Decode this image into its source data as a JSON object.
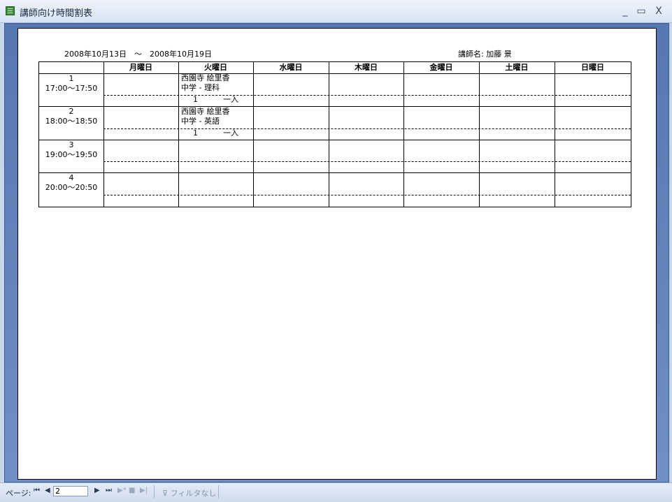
{
  "window": {
    "title": "講師向け時間割表",
    "minimize": "_",
    "maximize": "▭",
    "close": "X"
  },
  "report": {
    "date_range": "2008年10月13日　～　2008年10月19日",
    "teacher": "講師名: 加藤 景",
    "days": [
      "月曜日",
      "火曜日",
      "水曜日",
      "木曜日",
      "金曜日",
      "土曜日",
      "日曜日"
    ],
    "periods": [
      {
        "no": "1",
        "time": "17:00～17:50"
      },
      {
        "no": "2",
        "time": "18:00～18:50"
      },
      {
        "no": "3",
        "time": "19:00～19:50"
      },
      {
        "no": "4",
        "time": "20:00～20:50"
      }
    ],
    "entries": [
      {
        "student": "西園寺 絵里香",
        "subject": "中学 - 理科",
        "count": "1",
        "unit": "一入"
      },
      {
        "student": "西園寺 絵里香",
        "subject": "中学 - 英語",
        "count": "1",
        "unit": "一入"
      }
    ]
  },
  "statusbar": {
    "page_label": "ページ:",
    "page_value": "2",
    "filter": "フィルタなし"
  }
}
